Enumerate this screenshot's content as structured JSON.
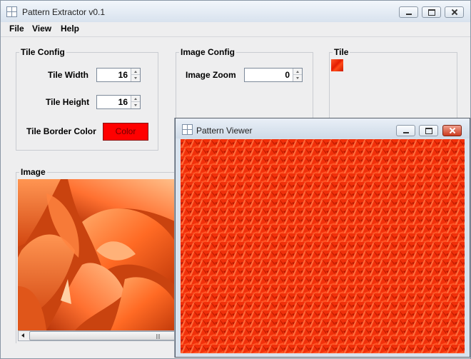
{
  "main_window": {
    "title": "Pattern Extractor v0.1",
    "menu": [
      "File",
      "View",
      "Help"
    ]
  },
  "tile_config": {
    "label": "Tile Config",
    "width_label": "Tile Width",
    "width_value": "16",
    "height_label": "Tile Height",
    "height_value": "16",
    "border_color_label": "Tile Border Color",
    "color_button_label": "Color",
    "border_color": "#ff0000"
  },
  "image_config": {
    "label": "Image Config",
    "zoom_label": "Image Zoom",
    "zoom_value": "0"
  },
  "tile_panel": {
    "label": "Tile"
  },
  "image_panel": {
    "label": "Image"
  },
  "viewer_window": {
    "title": "Pattern Viewer"
  },
  "colors": {
    "pattern_red": "#f2300a",
    "accent_orange": "#ff5a1e"
  },
  "icons": {
    "app": "grid-window-icon",
    "minimize": "minimize-icon",
    "maximize": "maximize-icon",
    "close": "close-icon"
  }
}
